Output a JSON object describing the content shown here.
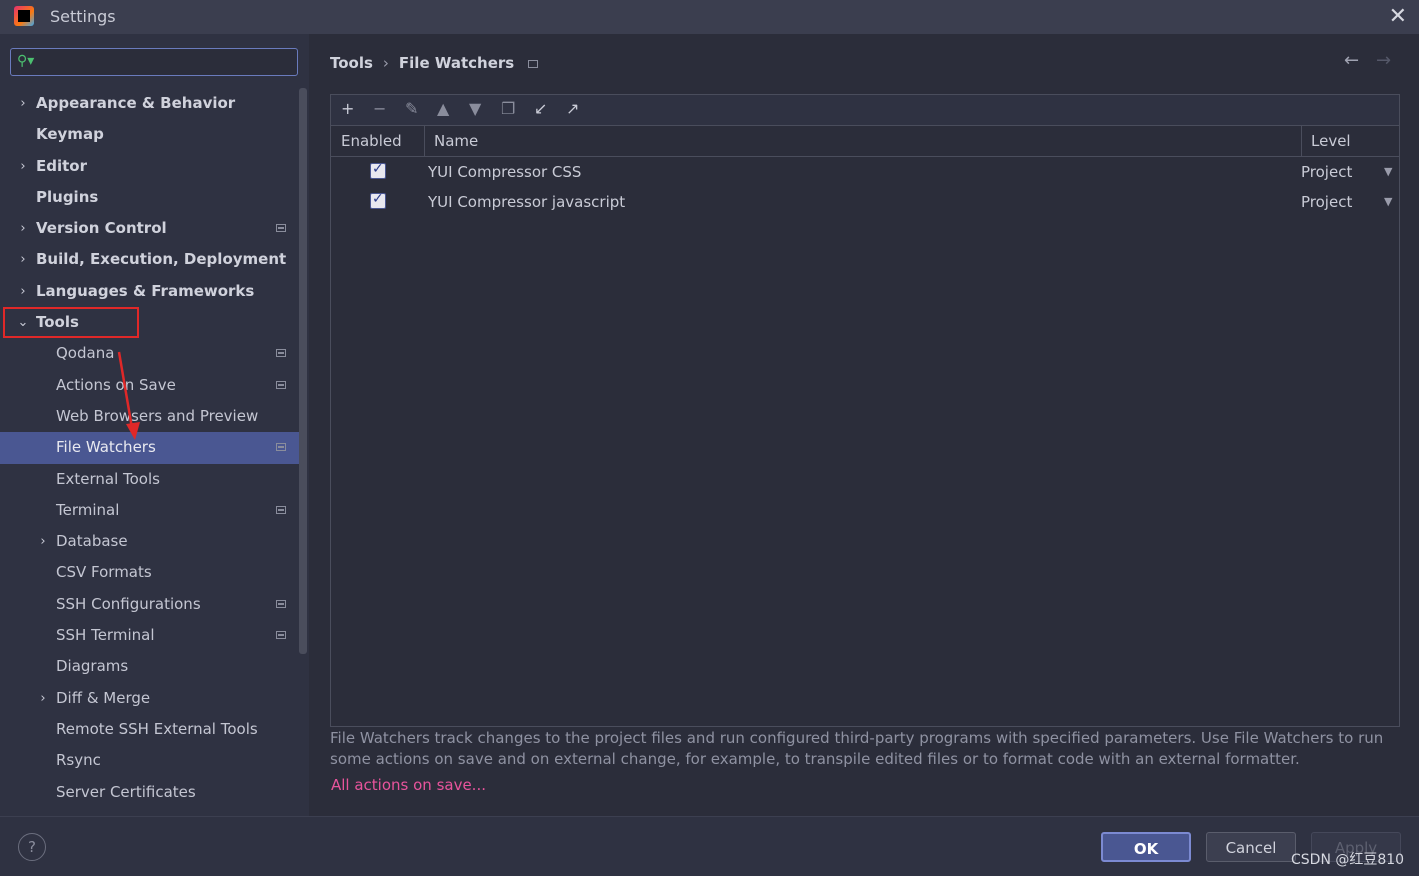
{
  "window": {
    "title": "Settings"
  },
  "search": {
    "placeholder": ""
  },
  "sidebar": {
    "items": [
      {
        "label": "Appearance & Behavior",
        "level": "top",
        "expandable": true,
        "expanded": false
      },
      {
        "label": "Keymap",
        "level": "top"
      },
      {
        "label": "Editor",
        "level": "top",
        "expandable": true,
        "expanded": false
      },
      {
        "label": "Plugins",
        "level": "top"
      },
      {
        "label": "Version Control",
        "level": "top",
        "expandable": true,
        "expanded": false,
        "project_icon": true
      },
      {
        "label": "Build, Execution, Deployment",
        "level": "top",
        "expandable": true,
        "expanded": false
      },
      {
        "label": "Languages & Frameworks",
        "level": "top",
        "expandable": true,
        "expanded": false
      },
      {
        "label": "Tools",
        "level": "top",
        "expandable": true,
        "expanded": true
      },
      {
        "label": "Qodana",
        "level": "sub",
        "project_icon": true
      },
      {
        "label": "Actions on Save",
        "level": "sub",
        "project_icon": true
      },
      {
        "label": "Web Browsers and Preview",
        "level": "sub"
      },
      {
        "label": "File Watchers",
        "level": "sub",
        "selected": true,
        "project_icon": true
      },
      {
        "label": "External Tools",
        "level": "sub"
      },
      {
        "label": "Terminal",
        "level": "sub",
        "project_icon": true
      },
      {
        "label": "Database",
        "level": "sub",
        "expandable": true,
        "expanded": false
      },
      {
        "label": "CSV Formats",
        "level": "sub"
      },
      {
        "label": "SSH Configurations",
        "level": "sub",
        "project_icon": true
      },
      {
        "label": "SSH Terminal",
        "level": "sub",
        "project_icon": true
      },
      {
        "label": "Diagrams",
        "level": "sub"
      },
      {
        "label": "Diff & Merge",
        "level": "sub",
        "expandable": true,
        "expanded": false
      },
      {
        "label": "Remote SSH External Tools",
        "level": "sub"
      },
      {
        "label": "Rsync",
        "level": "sub"
      },
      {
        "label": "Server Certificates",
        "level": "sub"
      }
    ]
  },
  "breadcrumb": {
    "parent": "Tools",
    "sep": "›",
    "current": "File Watchers"
  },
  "toolbar": {
    "icons": [
      "add-icon",
      "remove-icon",
      "edit-icon",
      "move-up-icon",
      "move-down-icon",
      "copy-icon",
      "import-icon",
      "export-icon"
    ]
  },
  "table": {
    "headers": {
      "enabled": "Enabled",
      "name": "Name",
      "level": "Level"
    },
    "rows": [
      {
        "enabled": true,
        "name": "YUI Compressor CSS",
        "level": "Project"
      },
      {
        "enabled": true,
        "name": "YUI Compressor javascript",
        "level": "Project"
      }
    ]
  },
  "description": "File Watchers track changes to the project files and run configured third-party programs with specified parameters. Use File Watchers to run some actions on save and on external change, for example, to transpile edited files or to format code with an external formatter.",
  "link": "All actions on save...",
  "buttons": {
    "ok": "OK",
    "cancel": "Cancel",
    "apply": "Apply",
    "help": "?"
  },
  "watermark": "CSDN @红豆810",
  "colors": {
    "accent": "#4a5792",
    "link": "#e8549c",
    "highlight_box": "#e02828"
  }
}
